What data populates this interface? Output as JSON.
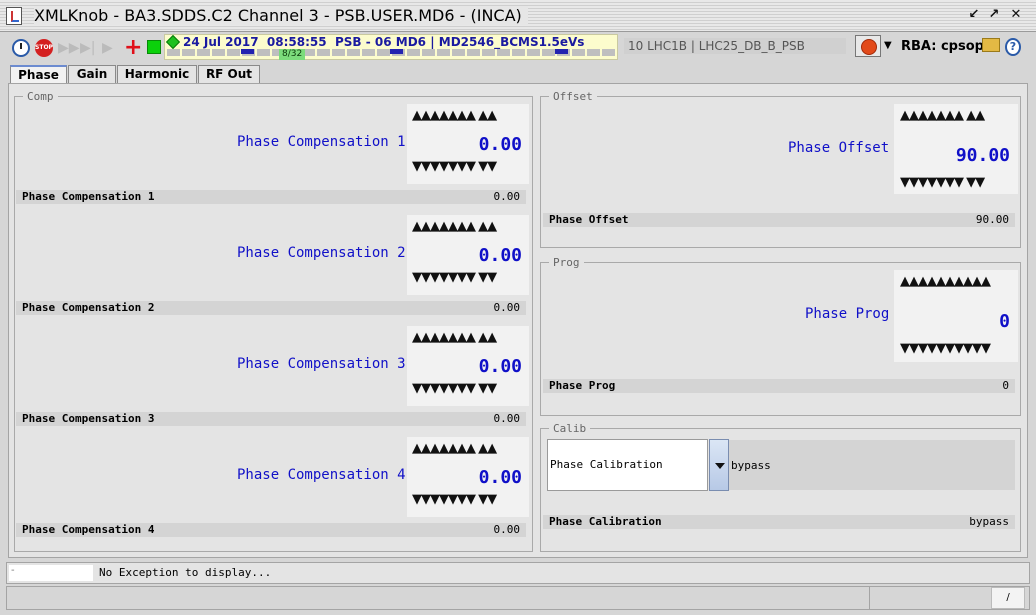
{
  "window": {
    "title": "XMLKnob - BA3.SDDS.C2 Channel 3 - PSB.USER.MD6 - (INCA)",
    "controls": [
      "↙",
      "↗",
      "✕"
    ]
  },
  "toolbar": {
    "timing_text": "24 Jul 2017  08:58:55  PSB - 06 MD6 | MD2546_BCMS1.5eVs",
    "cycle_count": "8/32",
    "context": "10 LHC1B | LHC25_DB_B_PSB",
    "rba_label": "RBA: cpsop",
    "stop_icon_text": "STOP",
    "dropdown_glyph": "▼",
    "help_glyph": "?",
    "icons": [
      "clock-icon",
      "stop-icon",
      "fast-forward-icon",
      "skip-icon",
      "play-icon",
      "plus-icon",
      "green-square-icon",
      "power-icon",
      "folder-icon",
      "help-icon"
    ]
  },
  "tabs": [
    {
      "label": "Phase",
      "active": true
    },
    {
      "label": "Gain",
      "active": false
    },
    {
      "label": "Harmonic",
      "active": false
    },
    {
      "label": "RF Out",
      "active": false
    }
  ],
  "comp": {
    "legend": "Comp",
    "arrows_up": "▲▲▲▲▲▲▲ ▲▲",
    "arrows_dn": "▼▼▼▼▼▼▼ ▼▼",
    "knobs": [
      {
        "label": "Phase Compensation 1",
        "value": "0.00",
        "row_label": "Phase Compensation 1",
        "row_value": "0.00"
      },
      {
        "label": "Phase Compensation 2",
        "value": "0.00",
        "row_label": "Phase Compensation 2",
        "row_value": "0.00"
      },
      {
        "label": "Phase Compensation 3",
        "value": "0.00",
        "row_label": "Phase Compensation 3",
        "row_value": "0.00"
      },
      {
        "label": "Phase Compensation 4",
        "value": "0.00",
        "row_label": "Phase Compensation 4",
        "row_value": "0.00"
      }
    ]
  },
  "offset": {
    "legend": "Offset",
    "arrows_up": "▲▲▲▲▲▲▲ ▲▲",
    "arrows_dn": "▼▼▼▼▼▼▼ ▼▼",
    "label": "Phase Offset",
    "value": "90.00",
    "row_label": "Phase Offset",
    "row_value": "90.00"
  },
  "prog": {
    "legend": "Prog",
    "arrows_up": "▲▲▲▲▲▲▲▲▲▲",
    "arrows_dn": "▼▼▼▼▼▼▼▼▼▼",
    "label": "Phase Prog",
    "value": "0",
    "row_label": "Phase Prog",
    "row_value": "0"
  },
  "calib": {
    "legend": "Calib",
    "combo_label": "Phase Calibration",
    "combo_state": "bypass",
    "row_label": "Phase Calibration",
    "row_value": "bypass"
  },
  "status": {
    "indicator": "-",
    "message": "No Exception to display...",
    "corner": "/"
  },
  "colors": {
    "value_blue": "#1010c8",
    "timing_bg": "#fcfccd",
    "active_tab": "#6c8bd0"
  }
}
